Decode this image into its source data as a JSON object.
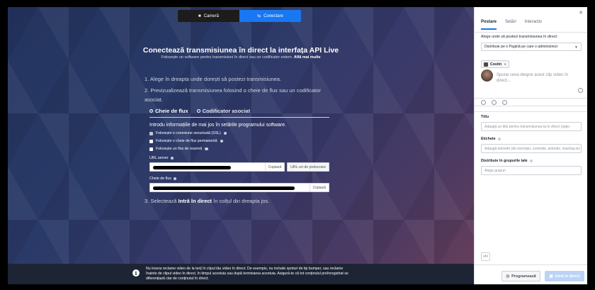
{
  "top_toggle": {
    "camera": "Cameră",
    "connect": "Conectare",
    "camera_icon": "video-camera-icon",
    "connect_icon": "connection-icon"
  },
  "main": {
    "title": "Conectează transmisiunea în direct la interfața API Live",
    "subtitle": "Folosește un software pentru transmisiuni în direct sau un codificator extern.",
    "learn_more": "Află mai multe",
    "step1": "1. Alege în dreapta unde dorești să postezi transmisiunea.",
    "step2": "2. Previzualizează transmisiunea folosind o cheie de flux sau un codificator asociat.",
    "tab_stream_key": "Cheie de flux",
    "tab_encoder": "Codificator asociat",
    "intro": "Introdu informațiile de mai jos în setările programului software.",
    "opt_ssl": "Folosește o conexiune securizată (SSL)",
    "opt_persistent": "Folosește o cheie de flux permanentă",
    "opt_backup": "Folosește un flux de rezervă",
    "server_url_label": "URL server",
    "copy_label": "Copiază",
    "preview_urls": "URL-uri de prelucrare",
    "stream_key_label": "Cheie de flux",
    "step3_pre": "3. Selectează",
    "step3_bold": "Intră în direct",
    "step3_post": "în colțul din dreapta jos."
  },
  "notice": {
    "text": "Nu insera reclame video de la terți în clipul tău video în direct. De exemplu, nu include spoturi de tip bumper, sau reclame înainte de clipul video în direct, în timpul acestuia sau după terminarea acestuia. Asigură-te că tot conținutul preînregistrat se diferențiază clar de conținutul în direct.",
    "icon": "info-icon"
  },
  "sidebar": {
    "tabs": [
      "Postare",
      "Setări",
      "Interactiv"
    ],
    "close_icon": "close-icon",
    "where_label": "Alege unde să postezi transmisiunea în direct:",
    "where_value": "Distribuie pe o Pagină pe care o administrezi",
    "page_name": "Costin",
    "post_placeholder": "Spune ceva despre acest clip video în direct...",
    "title_label": "Titlu",
    "title_placeholder": "Adaugă un titlu pentru transmisiunea ta în direct (opțio",
    "tags_label": "Etichete",
    "tags_placeholder": "Adaugă etichete (de exemplu: comedie, animale, machiaj etc",
    "groups_label": "Distribuie în grupurile tale",
    "groups_placeholder": "Alege grupuri",
    "code_icon": "code-icon",
    "schedule": "Programează",
    "go_live": "Intră în direct"
  }
}
